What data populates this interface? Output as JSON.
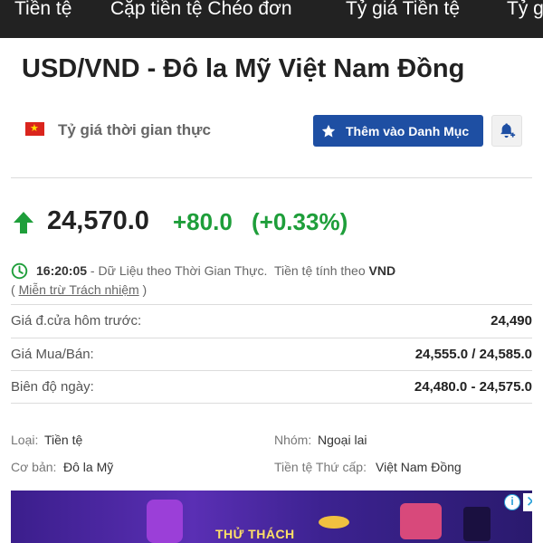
{
  "nav": {
    "items": [
      "Tiền tệ",
      "Cặp tiền tệ Chéo đơn",
      "Tỷ giá Tiền tệ",
      "Tỷ g"
    ]
  },
  "header": {
    "title": "USD/VND - Đô la Mỹ Việt Nam Đồng",
    "realtime_label": "Tỷ giá thời gian thực",
    "watchlist_button": "Thêm vào Danh Mục"
  },
  "quote": {
    "price": "24,570.0",
    "change": "+80.0",
    "change_pct": "(+0.33%)",
    "direction": "up",
    "up_color": "#1e9e3a"
  },
  "status": {
    "time": "16:20:05",
    "text_before": " - Dữ Liệu theo Thời Gian Thực.  Tiền tệ tính theo ",
    "currency": "VND",
    "disclaimer_open": "( ",
    "disclaimer": "Miễn trừ Trách nhiệm",
    "disclaimer_close": " )"
  },
  "stats": [
    {
      "label": "Giá đ.cửa hôm trước:",
      "value": "24,490"
    },
    {
      "label": "Giá Mua/Bán:",
      "value": "24,555.0 / 24,585.0"
    },
    {
      "label": "Biên độ ngày:",
      "value": "24,480.0 - 24,575.0"
    }
  ],
  "meta": {
    "type_key": "Loại:",
    "type_val": "Tiền tệ",
    "group_key": "Nhóm:",
    "group_val": "Ngoại lai",
    "base_key": "Cơ bản:",
    "base_val": "Đô la Mỹ",
    "quote_key": "Tiền tệ Thứ cấp:",
    "quote_val": "Việt Nam Đồng"
  },
  "ad": {
    "text": "THỬ THÁCH",
    "info_icon": "info-icon",
    "close_icon": "close-icon"
  },
  "colors": {
    "nav_bg": "#222222",
    "accent_blue": "#1e4fa3",
    "positive": "#1e9e3a"
  }
}
